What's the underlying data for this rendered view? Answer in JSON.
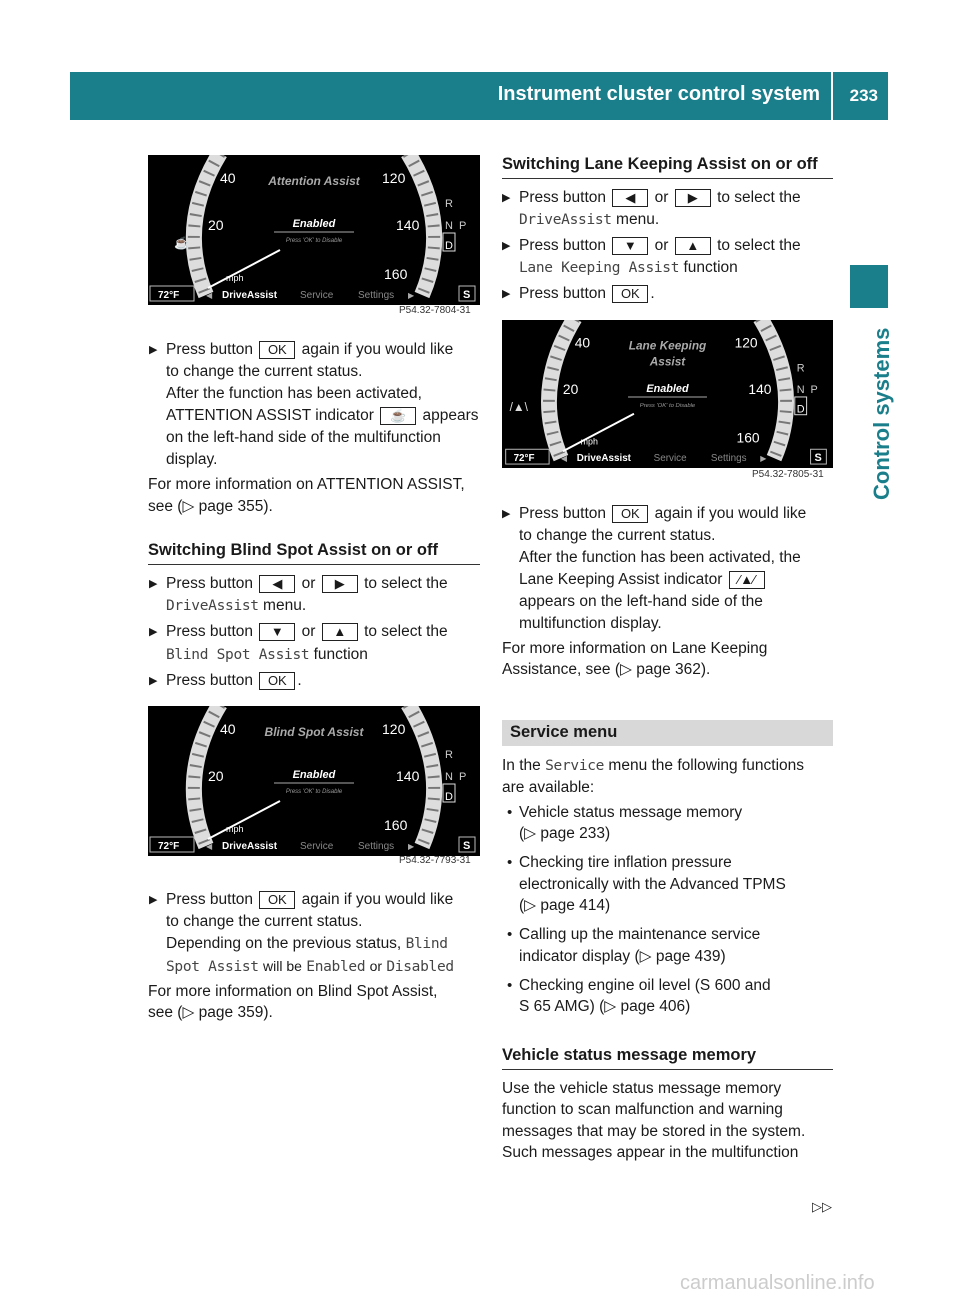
{
  "header": {
    "title": "Instrument cluster control system",
    "page": "233"
  },
  "side_tab": "Control systems",
  "common": {
    "bullet": "▶",
    "press_button": "Press button",
    "or": "or",
    "ok": "OK",
    "left_key": "◀",
    "right_key": "▶",
    "down_key": "▼",
    "up_key": "▲",
    "to_select": "to select the",
    "drive_assist": "DriveAssist",
    "menu": "menu.",
    "function": "function",
    "period": ".",
    "again": "again if you would like",
    "change_status": "to change the current status."
  },
  "left": {
    "p1_l3": "After the function has been activated,",
    "p1_l4a": "ATTENTION ASSIST indicator",
    "p1_l4b": "appears",
    "p1_l5": "on the left-hand side of the multifunction",
    "p1_l6": "display.",
    "p2_l1": "For more information on ATTENTION ASSIST,",
    "p2_l2": "see (▷ page 355).",
    "h_bsa": "Switching Blind Spot Assist on or off",
    "bsa_fn": "Blind Spot Assist",
    "p3_l3a": "Depending on the previous status,",
    "p3_l3b": "Blind",
    "p3_l4a": "Spot Assist",
    "p3_l4b": "will be",
    "p3_l4c": "Enabled",
    "p3_l4d": "or",
    "p3_l4e": "Disabled",
    "p4_l1": "For more information on Blind Spot Assist,",
    "p4_l2": "see (▷ page 359)."
  },
  "right": {
    "h_lka": "Switching Lane Keeping Assist on or off",
    "lka_fn": "Lane Keeping Assist",
    "p1_l3": "After the function has been activated, the",
    "p1_l4": "Lane Keeping Assist indicator",
    "p1_l5": "appears on the left-hand side of the",
    "p1_l6": "multifunction display.",
    "p2_l1": "For more information on Lane Keeping",
    "p2_l2": "Assistance, see (▷ page 362).",
    "service_heading": "Service menu",
    "svc_l1a": "In the",
    "svc_l1b": "Service",
    "svc_l1c": "menu the following functions",
    "svc_l2": "are available:",
    "items": [
      [
        "Vehicle status message memory",
        "(▷ page 233)"
      ],
      [
        "Checking tire inflation pressure",
        "electronically with the Advanced TPMS",
        "(▷ page 414)"
      ],
      [
        "Calling up the maintenance service",
        "indicator display (▷ page 439)"
      ],
      [
        "Checking engine oil level (S 600 and",
        "S 65 AMG) (▷ page 406)"
      ]
    ],
    "h_vsm": "Vehicle status message memory",
    "vsm": [
      "Use the vehicle status message memory",
      "function to scan malfunction and warning",
      "messages that may be stored in the system.",
      "Such messages appear in the multifunction"
    ]
  },
  "continue_mark": "▷▷",
  "watermark": "carmanualsonline.info",
  "clusters": [
    {
      "title": [
        "Attention Assist"
      ],
      "status": "Enabled",
      "hint": "Press 'OK' to Disable",
      "icon": "coffee-cup-icon",
      "figure": "P54.32-7804-31"
    },
    {
      "title": [
        "Blind Spot Assist"
      ],
      "status": "Enabled",
      "hint": "Press 'OK' to Disable",
      "icon": "",
      "figure": "P54.32-7793-31"
    },
    {
      "title": [
        "Lane Keeping",
        "Assist"
      ],
      "status": "Enabled",
      "hint": "Press 'OK' to Disable",
      "icon": "lane-keeping-icon",
      "figure": "P54.32-7805-31"
    }
  ],
  "cluster_common": {
    "speeds": [
      "40",
      "20",
      "120",
      "140",
      "160"
    ],
    "unit": "mph",
    "temp": "72°F",
    "menu": [
      "DriveAssist",
      "Service",
      "Settings"
    ],
    "gears": [
      "R",
      "N",
      "P",
      "D"
    ],
    "mode": "S"
  }
}
